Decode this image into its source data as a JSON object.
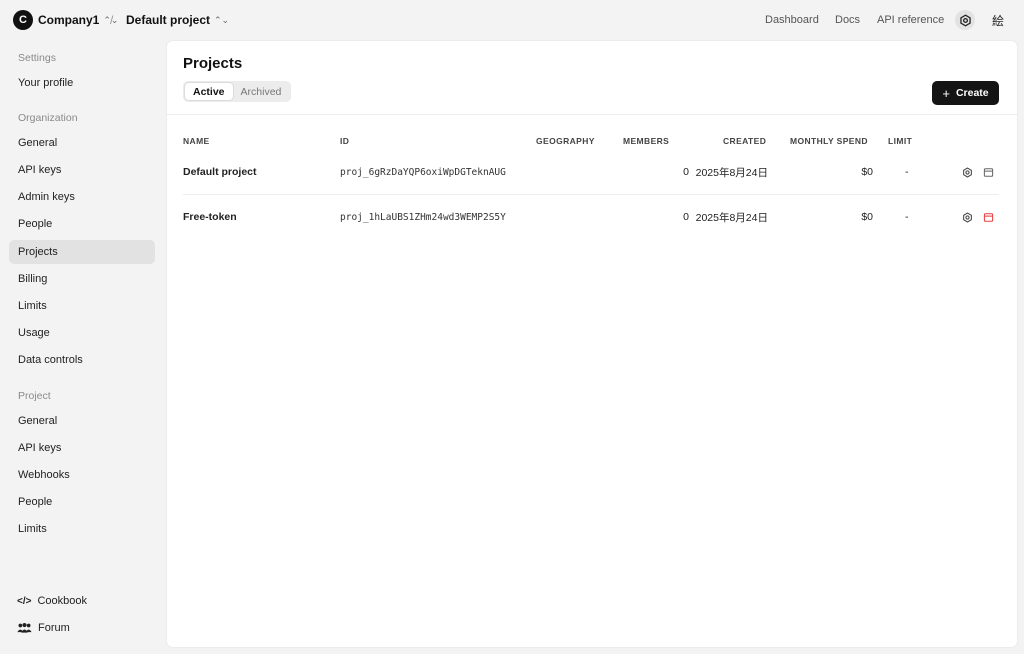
{
  "header": {
    "org_initial": "C",
    "org_name": "Company1",
    "separator": "/",
    "project_name": "Default project",
    "links": {
      "dashboard": "Dashboard",
      "docs": "Docs",
      "api_reference": "API reference"
    },
    "user_glyph": "絵"
  },
  "sidebar": {
    "settings_heading": "Settings",
    "your_profile": "Your profile",
    "org_heading": "Organization",
    "org_items": [
      "General",
      "API keys",
      "Admin keys",
      "People",
      "Projects",
      "Billing",
      "Limits",
      "Usage",
      "Data controls"
    ],
    "project_heading": "Project",
    "project_items": [
      "General",
      "API keys",
      "Webhooks",
      "People",
      "Limits"
    ],
    "footer": {
      "cookbook": "Cookbook",
      "forum": "Forum"
    }
  },
  "main": {
    "title": "Projects",
    "tabs": {
      "active": "Active",
      "archived": "Archived"
    },
    "create_label": "Create",
    "columns": {
      "name": "NAME",
      "id": "ID",
      "geography": "GEOGRAPHY",
      "members": "MEMBERS",
      "created": "CREATED",
      "monthly_spend": "MONTHLY SPEND",
      "limit": "LIMIT"
    },
    "rows": [
      {
        "name": "Default project",
        "id": "proj_6gRzDaYQP6oxiWpDGTeknAUG",
        "geography": "",
        "members": "0",
        "created": "2025年8月24日",
        "spend": "$0",
        "limit": "-"
      },
      {
        "name": "Free-token",
        "id": "proj_1hLaUBS1ZHm24wd3WEMP2S5Y",
        "geography": "",
        "members": "0",
        "created": "2025年8月24日",
        "spend": "$0",
        "limit": "-"
      }
    ]
  },
  "colors": {
    "accent_dark": "#141414",
    "archive_red": "#e53e3e",
    "active_bg": "#e2e2e2"
  },
  "icons": {
    "settings": "gear-icon",
    "archive": "archive-icon",
    "create": "plus-icon",
    "cookbook": "code-icon",
    "forum": "people-icon",
    "chevron": "chevron-updown-icon"
  }
}
